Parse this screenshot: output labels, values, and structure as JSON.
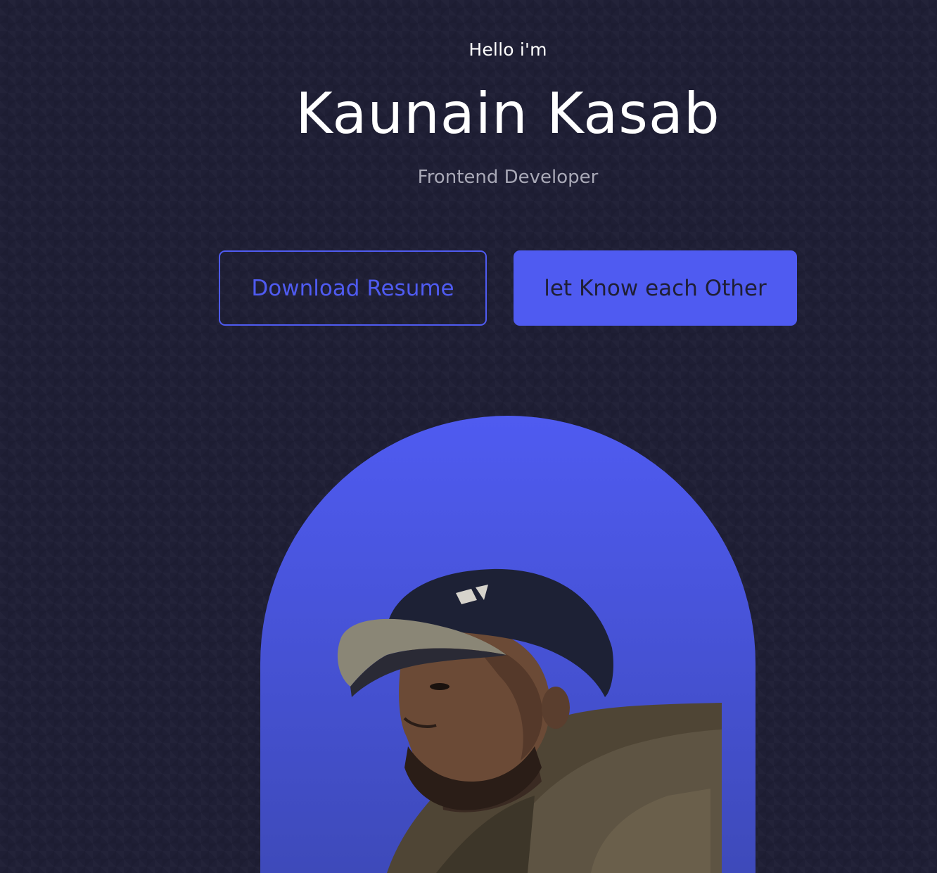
{
  "hero": {
    "greeting": "Hello i'm",
    "name": "Kaunain Kasab",
    "role": "Frontend Developer",
    "buttons": {
      "download": "Download Resume",
      "contact": "let Know each Other"
    }
  },
  "colors": {
    "background": "#1f1f35",
    "accent": "#4f5bf1",
    "text_primary": "#ffffff",
    "text_secondary": "#a9a9b7"
  },
  "portrait": {
    "icon": "person-photo"
  }
}
